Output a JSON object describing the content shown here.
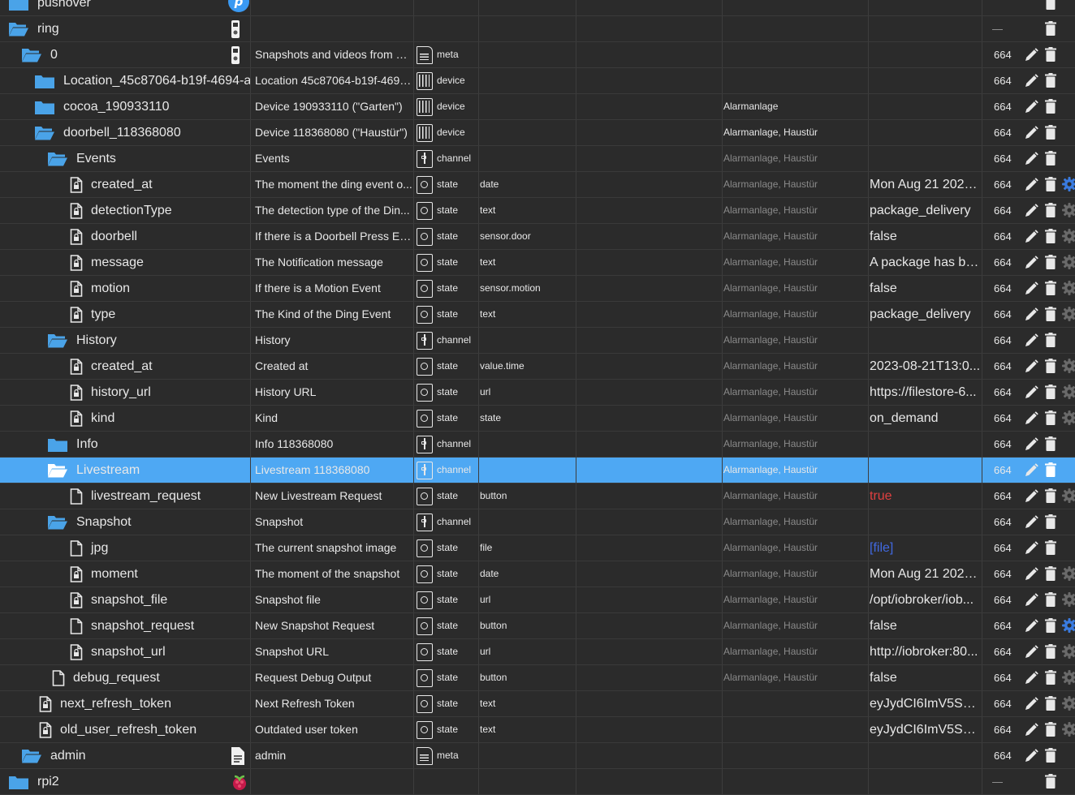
{
  "colors": {
    "background": "#2b2b2b",
    "selected_row": "#4ea8f3",
    "folder": "#4aa3e8",
    "value_red": "#e04040",
    "value_link": "#4169e1",
    "muted": "#8a8a8a"
  },
  "rows": [
    {
      "id": "pushover",
      "kind": "folder-closed",
      "indent": 0,
      "obj_icon": "pushover-logo-icon",
      "name": "",
      "type": "",
      "type_icon": "",
      "role": "",
      "room": "",
      "func": "",
      "val": "",
      "acl": "",
      "actions": [
        "trash"
      ],
      "partial_top": true
    },
    {
      "id": "ring",
      "kind": "folder-open",
      "indent": 0,
      "obj_icon": "ring-doorbell-icon",
      "name": "",
      "type": "",
      "type_icon": "",
      "role": "",
      "room": "",
      "func": "",
      "val": "",
      "acl": "—",
      "actions": [
        "trash"
      ]
    },
    {
      "id": "0",
      "kind": "folder-open",
      "indent": 1,
      "obj_icon": "ring-doorbell-icon",
      "name": "Snapshots and videos from Ri...",
      "type": "meta",
      "type_icon": "meta",
      "role": "",
      "room": "",
      "func": "",
      "val": "",
      "acl": "664",
      "actions": [
        "pencil",
        "trash"
      ]
    },
    {
      "id": "Location_45c87064-b19f-4694-a",
      "kind": "folder-closed",
      "indent": 2,
      "obj_icon": "",
      "name": "Location 45c87064-b19f-4694...",
      "type": "device",
      "type_icon": "device",
      "role": "",
      "room": "",
      "func": "",
      "val": "",
      "acl": "664",
      "actions": [
        "pencil",
        "trash"
      ]
    },
    {
      "id": "cocoa_190933110",
      "kind": "folder-closed",
      "indent": 2,
      "obj_icon": "",
      "name": "Device 190933110 (\"Garten\")",
      "type": "device",
      "type_icon": "device",
      "role": "",
      "room": "",
      "func": "Alarmanlage",
      "val": "",
      "acl": "664",
      "actions": [
        "pencil",
        "trash"
      ]
    },
    {
      "id": "doorbell_118368080",
      "kind": "folder-open",
      "indent": 2,
      "obj_icon": "",
      "name": "Device 118368080 (\"Haustür\")",
      "type": "device",
      "type_icon": "device",
      "role": "",
      "room": "",
      "func": "Alarmanlage, Haustür",
      "val": "",
      "acl": "664",
      "actions": [
        "pencil",
        "trash"
      ]
    },
    {
      "id": "Events",
      "kind": "folder-open",
      "indent": 3,
      "obj_icon": "",
      "name": "Events",
      "type": "channel",
      "type_icon": "channel",
      "role": "",
      "room": "",
      "func": "Alarmanlage, Haustür",
      "func_muted": true,
      "val": "",
      "acl": "664",
      "actions": [
        "pencil",
        "trash"
      ]
    },
    {
      "id": "created_at",
      "kind": "file-lock",
      "indent": 4,
      "obj_icon": "",
      "name": "The moment the ding event o...",
      "type": "state",
      "type_icon": "state",
      "role": "date",
      "room": "",
      "func": "Alarmanlage, Haustür",
      "func_muted": true,
      "val": "Mon Aug 21 2023...",
      "acl": "664",
      "actions": [
        "pencil",
        "trash",
        "gear-blue"
      ]
    },
    {
      "id": "detectionType",
      "kind": "file-lock",
      "indent": 4,
      "obj_icon": "",
      "name": "The detection type of the Din...",
      "type": "state",
      "type_icon": "state",
      "role": "text",
      "room": "",
      "func": "Alarmanlage, Haustür",
      "func_muted": true,
      "val": "package_delivery",
      "acl": "664",
      "actions": [
        "pencil",
        "trash",
        "gear"
      ]
    },
    {
      "id": "doorbell",
      "kind": "file-lock",
      "indent": 4,
      "obj_icon": "",
      "name": "If there is a Doorbell Press Ev...",
      "type": "state",
      "type_icon": "state",
      "role": "sensor.door",
      "room": "",
      "func": "Alarmanlage, Haustür",
      "func_muted": true,
      "val": "false",
      "acl": "664",
      "actions": [
        "pencil",
        "trash",
        "gear"
      ]
    },
    {
      "id": "message",
      "kind": "file-lock",
      "indent": 4,
      "obj_icon": "",
      "name": "The Notification message",
      "type": "state",
      "type_icon": "state",
      "role": "text",
      "room": "",
      "func": "Alarmanlage, Haustür",
      "func_muted": true,
      "val": "A package has be...",
      "acl": "664",
      "actions": [
        "pencil",
        "trash",
        "gear"
      ]
    },
    {
      "id": "motion",
      "kind": "file-lock",
      "indent": 4,
      "obj_icon": "",
      "name": "If there is a Motion Event",
      "type": "state",
      "type_icon": "state",
      "role": "sensor.motion",
      "room": "",
      "func": "Alarmanlage, Haustür",
      "func_muted": true,
      "val": "false",
      "acl": "664",
      "actions": [
        "pencil",
        "trash",
        "gear"
      ]
    },
    {
      "id": "type",
      "kind": "file-lock",
      "indent": 4,
      "obj_icon": "",
      "name": "The Kind of the Ding Event",
      "type": "state",
      "type_icon": "state",
      "role": "text",
      "room": "",
      "func": "Alarmanlage, Haustür",
      "func_muted": true,
      "val": "package_delivery",
      "acl": "664",
      "actions": [
        "pencil",
        "trash",
        "gear"
      ]
    },
    {
      "id": "History",
      "kind": "folder-open",
      "indent": 3,
      "obj_icon": "",
      "name": "History",
      "type": "channel",
      "type_icon": "channel",
      "role": "",
      "room": "",
      "func": "Alarmanlage, Haustür",
      "func_muted": true,
      "val": "",
      "acl": "664",
      "actions": [
        "pencil",
        "trash"
      ]
    },
    {
      "id": "created_at",
      "kind": "file-lock",
      "indent": 4,
      "obj_icon": "",
      "name": "Created at",
      "type": "state",
      "type_icon": "state",
      "role": "value.time",
      "room": "",
      "func": "Alarmanlage, Haustür",
      "func_muted": true,
      "val": "2023-08-21T13:0...",
      "acl": "664",
      "actions": [
        "pencil",
        "trash",
        "gear"
      ]
    },
    {
      "id": "history_url",
      "kind": "file-lock",
      "indent": 4,
      "obj_icon": "",
      "name": "History URL",
      "type": "state",
      "type_icon": "state",
      "role": "url",
      "room": "",
      "func": "Alarmanlage, Haustür",
      "func_muted": true,
      "val": "https://filestore-6...",
      "acl": "664",
      "actions": [
        "pencil",
        "trash",
        "gear"
      ]
    },
    {
      "id": "kind",
      "kind": "file-lock",
      "indent": 4,
      "obj_icon": "",
      "name": "Kind",
      "type": "state",
      "type_icon": "state",
      "role": "state",
      "room": "",
      "func": "Alarmanlage, Haustür",
      "func_muted": true,
      "val": "on_demand",
      "acl": "664",
      "actions": [
        "pencil",
        "trash",
        "gear"
      ]
    },
    {
      "id": "Info",
      "kind": "folder-closed",
      "indent": 3,
      "obj_icon": "",
      "name": "Info 118368080",
      "type": "channel",
      "type_icon": "channel",
      "role": "",
      "room": "",
      "func": "Alarmanlage, Haustür",
      "func_muted": true,
      "val": "",
      "acl": "664",
      "actions": [
        "pencil",
        "trash"
      ]
    },
    {
      "id": "Livestream",
      "kind": "folder-open",
      "indent": 3,
      "obj_icon": "",
      "name": "Livestream 118368080",
      "type": "channel",
      "type_icon": "channel",
      "role": "",
      "room": "",
      "func": "Alarmanlage, Haustür",
      "func_muted": true,
      "val": "",
      "acl": "664",
      "actions": [
        "pencil",
        "trash"
      ],
      "selected": true
    },
    {
      "id": "livestream_request",
      "kind": "file",
      "indent": 4,
      "obj_icon": "",
      "name": "New Livestream Request",
      "type": "state",
      "type_icon": "state",
      "role": "button",
      "room": "",
      "func": "Alarmanlage, Haustür",
      "func_muted": true,
      "val": "true",
      "val_style": "red",
      "acl": "664",
      "actions": [
        "pencil",
        "trash",
        "gear"
      ]
    },
    {
      "id": "Snapshot",
      "kind": "folder-open",
      "indent": 3,
      "obj_icon": "",
      "name": "Snapshot",
      "type": "channel",
      "type_icon": "channel",
      "role": "",
      "room": "",
      "func": "Alarmanlage, Haustür",
      "func_muted": true,
      "val": "",
      "acl": "664",
      "actions": [
        "pencil",
        "trash"
      ]
    },
    {
      "id": "jpg",
      "kind": "file",
      "indent": 4,
      "obj_icon": "",
      "name": "The current snapshot image",
      "type": "state",
      "type_icon": "state",
      "role": "file",
      "room": "",
      "func": "Alarmanlage, Haustür",
      "func_muted": true,
      "val": "[file]",
      "val_style": "link",
      "acl": "664",
      "actions": [
        "pencil",
        "trash"
      ]
    },
    {
      "id": "moment",
      "kind": "file-lock",
      "indent": 4,
      "obj_icon": "",
      "name": "The moment of the snapshot",
      "type": "state",
      "type_icon": "state",
      "role": "date",
      "room": "",
      "func": "Alarmanlage, Haustür",
      "func_muted": true,
      "val": "Mon Aug 21 2023...",
      "acl": "664",
      "actions": [
        "pencil",
        "trash",
        "gear"
      ]
    },
    {
      "id": "snapshot_file",
      "kind": "file-lock",
      "indent": 4,
      "obj_icon": "",
      "name": "Snapshot file",
      "type": "state",
      "type_icon": "state",
      "role": "url",
      "room": "",
      "func": "Alarmanlage, Haustür",
      "func_muted": true,
      "val": "/opt/iobroker/iob...",
      "acl": "664",
      "actions": [
        "pencil",
        "trash",
        "gear"
      ]
    },
    {
      "id": "snapshot_request",
      "kind": "file",
      "indent": 4,
      "obj_icon": "",
      "name": "New Snapshot Request",
      "type": "state",
      "type_icon": "state",
      "role": "button",
      "room": "",
      "func": "Alarmanlage, Haustür",
      "func_muted": true,
      "val": "false",
      "acl": "664",
      "actions": [
        "pencil",
        "trash",
        "gear-blue"
      ]
    },
    {
      "id": "snapshot_url",
      "kind": "file-lock",
      "indent": 4,
      "obj_icon": "",
      "name": "Snapshot URL",
      "type": "state",
      "type_icon": "state",
      "role": "url",
      "room": "",
      "func": "Alarmanlage, Haustür",
      "func_muted": true,
      "val": "http://iobroker:80...",
      "acl": "664",
      "actions": [
        "pencil",
        "trash",
        "gear"
      ]
    },
    {
      "id": "debug_request",
      "kind": "file",
      "indent": 3,
      "obj_icon": "",
      "name": "Request Debug Output",
      "type": "state",
      "type_icon": "state",
      "role": "button",
      "room": "",
      "func": "Alarmanlage, Haustür",
      "func_muted": true,
      "val": "false",
      "acl": "664",
      "actions": [
        "pencil",
        "trash",
        "gear"
      ]
    },
    {
      "id": "next_refresh_token",
      "kind": "file-lock",
      "indent": 2,
      "obj_icon": "",
      "name": "Next Refresh Token",
      "type": "state",
      "type_icon": "state",
      "role": "text",
      "room": "",
      "func": "",
      "val": "eyJydCI6ImV5Sm...",
      "acl": "664",
      "actions": [
        "pencil",
        "trash",
        "gear"
      ]
    },
    {
      "id": "old_user_refresh_token",
      "kind": "file-lock",
      "indent": 2,
      "obj_icon": "",
      "name": "Outdated user token",
      "type": "state",
      "type_icon": "state",
      "role": "text",
      "room": "",
      "func": "",
      "val": "eyJydCI6ImV5Sm...",
      "acl": "664",
      "actions": [
        "pencil",
        "trash",
        "gear"
      ]
    },
    {
      "id": "admin",
      "kind": "folder-open",
      "indent": 1,
      "obj_icon": "document-icon",
      "name": "admin",
      "type": "meta",
      "type_icon": "meta",
      "role": "",
      "room": "",
      "func": "",
      "val": "",
      "acl": "664",
      "actions": [
        "pencil",
        "trash"
      ]
    },
    {
      "id": "rpi2",
      "kind": "folder-closed",
      "indent": 0,
      "obj_icon": "raspberry-pi-icon",
      "name": "",
      "type": "",
      "type_icon": "",
      "role": "",
      "room": "",
      "func": "",
      "val": "",
      "acl": "—",
      "actions": [
        "trash"
      ],
      "partial_bottom": true
    }
  ]
}
